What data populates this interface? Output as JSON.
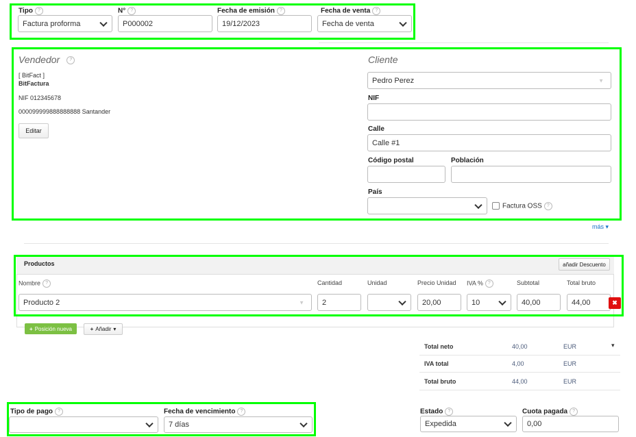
{
  "header": {
    "tipo_label": "Tipo",
    "tipo_value": "Factura proforma",
    "numero_label": "N°",
    "numero_value": "P000002",
    "fecha_emision_label": "Fecha de emisión",
    "fecha_emision_value": "19/12/2023",
    "fecha_venta_label": "Fecha de venta",
    "fecha_venta_value": "Fecha de venta"
  },
  "vendedor": {
    "title": "Vendedor",
    "tag": "[ BitFact ]",
    "name": "BitFactura",
    "nif": "NIF 012345678",
    "account": "000099999888888888 Santander",
    "edit_label": "Editar"
  },
  "cliente": {
    "title": "Cliente",
    "name_value": "Pedro Perez",
    "nif_label": "NIF",
    "nif_value": "",
    "calle_label": "Calle",
    "calle_value": "Calle #1",
    "cp_label": "Código postal",
    "cp_value": "",
    "poblacion_label": "Población",
    "poblacion_value": "",
    "pais_label": "País",
    "pais_value": "",
    "oss_label": "Factura OSS",
    "more_label": "más ▾"
  },
  "productos": {
    "title": "Productos",
    "discount_label": "añadir Descuento",
    "columns": {
      "nombre": "Nombre",
      "cantidad": "Cantidad",
      "unidad": "Unidad",
      "precio": "Precio Unidad",
      "iva": "IVA %",
      "subtotal": "Subtotal",
      "total": "Total bruto"
    },
    "rows": [
      {
        "nombre": "Producto 2",
        "cantidad": "2",
        "unidad": "",
        "precio": "20,00",
        "iva": "10",
        "subtotal": "40,00",
        "total": "44,00"
      }
    ],
    "new_position_label": "Posición nueva",
    "add_label": "Añadir"
  },
  "totals": [
    {
      "label": "Total neto",
      "value": "40,00",
      "currency": "EUR"
    },
    {
      "label": "IVA total",
      "value": "4,00",
      "currency": "EUR"
    },
    {
      "label": "Total bruto",
      "value": "44,00",
      "currency": "EUR"
    }
  ],
  "payment": {
    "tipo_pago_label": "Tipo de pago",
    "tipo_pago_value": "",
    "vencimiento_label": "Fecha de vencimiento",
    "vencimiento_value": "7 días",
    "estado_label": "Estado",
    "estado_value": "Expedida",
    "cuota_label": "Cuota pagada",
    "cuota_value": "0,00"
  },
  "colors": {
    "highlight": "#00ff00",
    "link": "#1a73c8",
    "new_button": "#7cc043",
    "delete": "#e01010"
  }
}
